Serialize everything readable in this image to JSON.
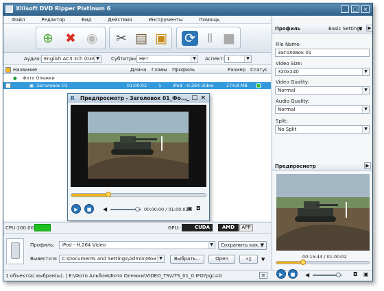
{
  "window": {
    "title": "Xilisoft DVD Ripper Platinum 6",
    "minimize": "_",
    "maximize": "□",
    "close": "×"
  },
  "menu": [
    "Файл",
    "Редактор",
    "Вид",
    "Действия",
    "Инструменты",
    "Помощь"
  ],
  "toolbar": {
    "icons": [
      "add-icon",
      "delete-icon",
      "disc-icon",
      "cut-icon",
      "film-icon",
      "effects-icon",
      "convert-icon",
      "pause-icon",
      "stop-icon"
    ]
  },
  "filters": {
    "audio_label": "Аудио:",
    "audio_value": "English AC3 2ch (0x80)",
    "subtitles_label": "Субтитры:",
    "subtitles_value": "Нет",
    "aspect_label": "Аспект:",
    "aspect_value": "1"
  },
  "table": {
    "headers": [
      "Название",
      "Длина",
      "Главы",
      "Профиль",
      "Размер",
      "Статус"
    ],
    "group": "Фото Олежки",
    "rows": [
      {
        "name": "Заголовок 01",
        "length": "01:00:02",
        "chapters": "1",
        "profile": "iPod - H.264 Video",
        "size": "274.8 MB",
        "status": "ready"
      }
    ]
  },
  "preview_window": {
    "title": "Предпросмотр - Заголовок 01_Фо...",
    "time": "00:00:00 / 01:00:02"
  },
  "cpu": {
    "label": "CPU:100.00%",
    "gpu_label": "GPU:",
    "cuda": "CUDA",
    "amd": "AMD",
    "app": "APP"
  },
  "bottom": {
    "profile_label": "Профиль:",
    "profile_value": "iPod - H.264 Video",
    "save_as": "Сохранить как...",
    "output_label": "Вывести в:",
    "output_value": "C:\\Documents and Settings\\Admin\\Мои докумен...",
    "browse": "Выбрать...",
    "open": "Open"
  },
  "status": {
    "text": "1 объект(а) выбран(ы). | E:\\Фото Альбом\\Фото Олежки\\VIDEO_TS\\VTS_01_0.IFO?pgc=0"
  },
  "right_panel": {
    "profile_title": "Профиль",
    "basic_settings": "Basic Settings",
    "file_name_label": "File Name:",
    "file_name": "Заголовок 01",
    "video_size_label": "Video Size:",
    "video_size": "320x240",
    "video_quality_label": "Video Quality:",
    "video_quality": "Normal",
    "audio_quality_label": "Audio Quality:",
    "audio_quality": "Normal",
    "split_label": "Split:",
    "split": "No Split",
    "preview_title": "Предпросмотр",
    "preview_time": "00:15:44 / 01:00:02",
    "preview_progress": 0.26
  },
  "colors": {
    "accent": "#2f6088",
    "selection": "#3399dd",
    "progress": "#f3b21b"
  }
}
